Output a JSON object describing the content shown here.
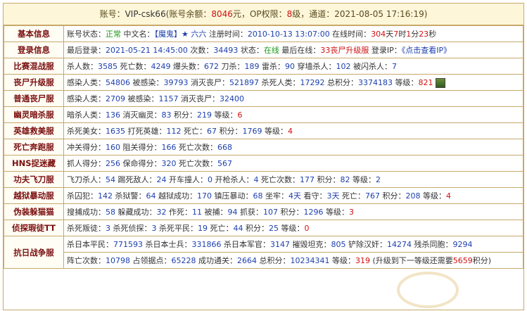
{
  "header": {
    "account_label": "账号：",
    "account": "VIP-csk66",
    "balance_prefix": "(账号余额：",
    "balance": "8046",
    "balance_suffix": "元，OP权限：",
    "op_level": "8",
    "op_suffix": "级，通道：",
    "datetime": "2021-08-05 17:16:19",
    "close": ")"
  },
  "rows": [
    {
      "label": "基本信息",
      "parts": [
        {
          "t": "账号状态：",
          "c": ""
        },
        {
          "t": "正常",
          "c": "green"
        },
        {
          "t": " 中文名：",
          "c": ""
        },
        {
          "t": "【魔鬼】★ 六六",
          "c": "blue"
        },
        {
          "t": " 注册时间：",
          "c": ""
        },
        {
          "t": "2010-10-13 13:07:00",
          "c": "num"
        },
        {
          "t": " 在线时间：",
          "c": ""
        },
        {
          "t": "304",
          "c": "numred"
        },
        {
          "t": "天",
          "c": ""
        },
        {
          "t": "7",
          "c": "numred"
        },
        {
          "t": "时",
          "c": ""
        },
        {
          "t": "1",
          "c": "numred"
        },
        {
          "t": "分",
          "c": ""
        },
        {
          "t": "23",
          "c": "numred"
        },
        {
          "t": "秒",
          "c": ""
        }
      ]
    },
    {
      "label": "登录信息",
      "parts": [
        {
          "t": "最后登录：",
          "c": ""
        },
        {
          "t": "2021-05-21 14:45:00",
          "c": "num"
        },
        {
          "t": " 次数：",
          "c": ""
        },
        {
          "t": "34493",
          "c": "num"
        },
        {
          "t": " 状态：",
          "c": ""
        },
        {
          "t": "在线",
          "c": "green"
        },
        {
          "t": " 最后在线：",
          "c": ""
        },
        {
          "t": "33丧尸升级服",
          "c": "numred"
        },
        {
          "t": " 登录IP：",
          "c": ""
        },
        {
          "t": "《点击查看IP》",
          "c": "blue"
        }
      ]
    },
    {
      "label": "比赛混战服",
      "parts": [
        {
          "t": "杀人数：",
          "c": ""
        },
        {
          "t": "3585",
          "c": "num"
        },
        {
          "t": " 死亡数：",
          "c": ""
        },
        {
          "t": "4249",
          "c": "num"
        },
        {
          "t": " 爆头数：",
          "c": ""
        },
        {
          "t": "672",
          "c": "num"
        },
        {
          "t": " 刀杀：",
          "c": ""
        },
        {
          "t": "189",
          "c": "num"
        },
        {
          "t": " 雷杀：",
          "c": ""
        },
        {
          "t": "90",
          "c": "num"
        },
        {
          "t": " 穿墙杀人：",
          "c": ""
        },
        {
          "t": "102",
          "c": "num"
        },
        {
          "t": " 被闪杀人：",
          "c": ""
        },
        {
          "t": "7",
          "c": "num"
        }
      ]
    },
    {
      "label": "丧尸升级服",
      "avatar": true,
      "parts": [
        {
          "t": "感染人类：",
          "c": ""
        },
        {
          "t": "54806",
          "c": "num"
        },
        {
          "t": " 被感染：",
          "c": ""
        },
        {
          "t": "39793",
          "c": "num"
        },
        {
          "t": " 消灭丧尸：",
          "c": ""
        },
        {
          "t": "521897",
          "c": "num"
        },
        {
          "t": " 杀死人类：",
          "c": ""
        },
        {
          "t": "17292",
          "c": "num"
        },
        {
          "t": " 总积分：",
          "c": ""
        },
        {
          "t": "3374183",
          "c": "num"
        },
        {
          "t": " 等级：",
          "c": ""
        },
        {
          "t": "821",
          "c": "numred"
        }
      ]
    },
    {
      "label": "普通丧尸服",
      "parts": [
        {
          "t": "感染人类：",
          "c": ""
        },
        {
          "t": "2709",
          "c": "num"
        },
        {
          "t": " 被感染：",
          "c": ""
        },
        {
          "t": "1157",
          "c": "num"
        },
        {
          "t": " 消灭丧尸：",
          "c": ""
        },
        {
          "t": "32400",
          "c": "num"
        }
      ]
    },
    {
      "label": "幽灵暗杀服",
      "parts": [
        {
          "t": "暗杀人类：",
          "c": ""
        },
        {
          "t": "136",
          "c": "num"
        },
        {
          "t": " 消灭幽灵：",
          "c": ""
        },
        {
          "t": "83",
          "c": "num"
        },
        {
          "t": " 积分：",
          "c": ""
        },
        {
          "t": "219",
          "c": "num"
        },
        {
          "t": " 等级：",
          "c": ""
        },
        {
          "t": "6",
          "c": "numred"
        }
      ]
    },
    {
      "label": "英雄救美服",
      "parts": [
        {
          "t": "杀死美女：",
          "c": ""
        },
        {
          "t": "1635",
          "c": "num"
        },
        {
          "t": " 打死英雄：",
          "c": ""
        },
        {
          "t": "112",
          "c": "num"
        },
        {
          "t": " 死亡：",
          "c": ""
        },
        {
          "t": "67",
          "c": "num"
        },
        {
          "t": " 积分：",
          "c": ""
        },
        {
          "t": "1769",
          "c": "num"
        },
        {
          "t": " 等级：",
          "c": ""
        },
        {
          "t": "4",
          "c": "numred"
        }
      ]
    },
    {
      "label": "死亡奔跑服",
      "parts": [
        {
          "t": "冲关得分：",
          "c": ""
        },
        {
          "t": "160",
          "c": "num"
        },
        {
          "t": " 阻关得分：",
          "c": ""
        },
        {
          "t": "166",
          "c": "num"
        },
        {
          "t": " 死亡次数：",
          "c": ""
        },
        {
          "t": "668",
          "c": "num"
        }
      ]
    },
    {
      "label": "HNS捉迷藏",
      "parts": [
        {
          "t": "抓人得分：",
          "c": ""
        },
        {
          "t": "256",
          "c": "num"
        },
        {
          "t": " 保命得分：",
          "c": ""
        },
        {
          "t": "320",
          "c": "num"
        },
        {
          "t": " 死亡次数：",
          "c": ""
        },
        {
          "t": "567",
          "c": "num"
        }
      ]
    },
    {
      "label": "功夫飞刀服",
      "parts": [
        {
          "t": "飞刀杀人：",
          "c": ""
        },
        {
          "t": "54",
          "c": "num"
        },
        {
          "t": " 踢死敌人：",
          "c": ""
        },
        {
          "t": "24",
          "c": "num"
        },
        {
          "t": " 开车撞人：",
          "c": ""
        },
        {
          "t": "0",
          "c": "num"
        },
        {
          "t": " 开枪杀人：",
          "c": ""
        },
        {
          "t": "4",
          "c": "num"
        },
        {
          "t": " 死亡次数：",
          "c": ""
        },
        {
          "t": "177",
          "c": "num"
        },
        {
          "t": " 积分：",
          "c": ""
        },
        {
          "t": "82",
          "c": "num"
        },
        {
          "t": " 等级：",
          "c": ""
        },
        {
          "t": "2",
          "c": "num"
        }
      ]
    },
    {
      "label": "越狱暴动服",
      "parts": [
        {
          "t": "杀囚犯：",
          "c": ""
        },
        {
          "t": "142",
          "c": "num"
        },
        {
          "t": " 杀狱警：",
          "c": ""
        },
        {
          "t": "64",
          "c": "num"
        },
        {
          "t": " 越狱成功：",
          "c": ""
        },
        {
          "t": "170",
          "c": "num"
        },
        {
          "t": " 镇压暴动：",
          "c": ""
        },
        {
          "t": "68",
          "c": "num"
        },
        {
          "t": " 坐牢：",
          "c": ""
        },
        {
          "t": "4天",
          "c": "num"
        },
        {
          "t": " 看守：",
          "c": ""
        },
        {
          "t": "3天",
          "c": "num"
        },
        {
          "t": " 死亡：",
          "c": ""
        },
        {
          "t": "767",
          "c": "num"
        },
        {
          "t": " 积分：",
          "c": ""
        },
        {
          "t": "208",
          "c": "num"
        },
        {
          "t": " 等级：",
          "c": ""
        },
        {
          "t": "4",
          "c": "numred"
        }
      ]
    },
    {
      "label": "伪装躲猫猫",
      "parts": [
        {
          "t": "搜捕成功：",
          "c": ""
        },
        {
          "t": "58",
          "c": "num"
        },
        {
          "t": " 躲藏成功：",
          "c": ""
        },
        {
          "t": "32",
          "c": "num"
        },
        {
          "t": " 作死：",
          "c": ""
        },
        {
          "t": "11",
          "c": "num"
        },
        {
          "t": " 被捕：",
          "c": ""
        },
        {
          "t": "94",
          "c": "num"
        },
        {
          "t": " 抓获：",
          "c": ""
        },
        {
          "t": "107",
          "c": "num"
        },
        {
          "t": " 积分：",
          "c": ""
        },
        {
          "t": "1296",
          "c": "num"
        },
        {
          "t": " 等级：",
          "c": ""
        },
        {
          "t": "3",
          "c": "numred"
        }
      ]
    },
    {
      "label": "侦探瑕徒TT",
      "parts": [
        {
          "t": "杀死叛徒：",
          "c": ""
        },
        {
          "t": "3",
          "c": "num"
        },
        {
          "t": " 杀死侦探：",
          "c": ""
        },
        {
          "t": "3",
          "c": "num"
        },
        {
          "t": " 杀死平民：",
          "c": ""
        },
        {
          "t": "19",
          "c": "num"
        },
        {
          "t": " 死亡：",
          "c": ""
        },
        {
          "t": "44",
          "c": "num"
        },
        {
          "t": " 积分：",
          "c": ""
        },
        {
          "t": "25",
          "c": "num"
        },
        {
          "t": " 等级：",
          "c": ""
        },
        {
          "t": "0",
          "c": "numred"
        }
      ]
    },
    {
      "label": "抗日战争服",
      "two_line": true,
      "parts": [
        {
          "t": "杀日本平民：",
          "c": ""
        },
        {
          "t": "771593",
          "c": "num"
        },
        {
          "t": " 杀日本士兵：",
          "c": ""
        },
        {
          "t": "331866",
          "c": "num"
        },
        {
          "t": " 杀日本军官：",
          "c": ""
        },
        {
          "t": "3147",
          "c": "num"
        },
        {
          "t": " 摧毁坦克：",
          "c": ""
        },
        {
          "t": "805",
          "c": "num"
        },
        {
          "t": " 铲除汉奸：",
          "c": ""
        },
        {
          "t": "14274",
          "c": "num"
        },
        {
          "t": " 残杀同胞：",
          "c": ""
        },
        {
          "t": "9294",
          "c": "num"
        }
      ],
      "parts2": [
        {
          "t": "阵亡次数：",
          "c": ""
        },
        {
          "t": "10798",
          "c": "num"
        },
        {
          "t": " 占领据点：",
          "c": ""
        },
        {
          "t": "65228",
          "c": "num"
        },
        {
          "t": " 成功通关：",
          "c": ""
        },
        {
          "t": "2664",
          "c": "num"
        },
        {
          "t": " 总积分：",
          "c": ""
        },
        {
          "t": "10234341",
          "c": "num"
        },
        {
          "t": " 等级：",
          "c": ""
        },
        {
          "t": "319",
          "c": "numred"
        },
        {
          "t": " (升级到下一等级还需要",
          "c": ""
        },
        {
          "t": "5659",
          "c": "numred"
        },
        {
          "t": "积分)",
          "c": ""
        }
      ]
    }
  ]
}
